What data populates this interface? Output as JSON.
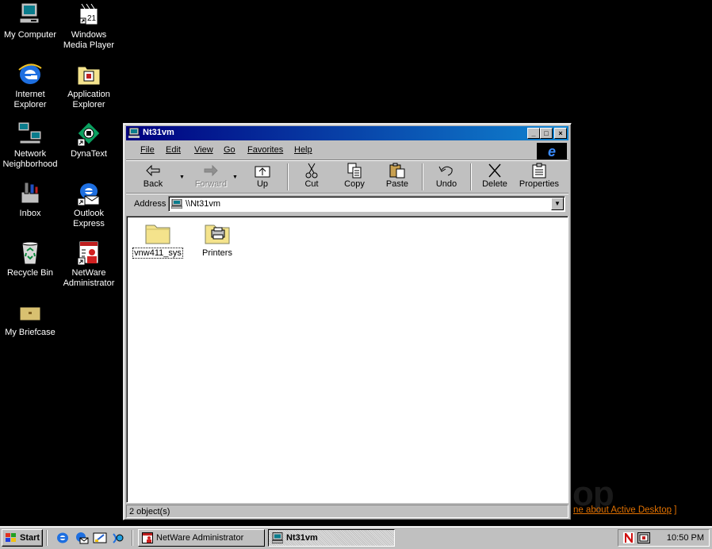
{
  "desktop": {
    "icons": [
      {
        "label": "My Computer",
        "icon": "my-computer-icon"
      },
      {
        "label": "Windows\nMedia Player",
        "icon": "media-player-icon"
      },
      {
        "label": "Internet\nExplorer",
        "icon": "internet-explorer-icon"
      },
      {
        "label": "Application\nExplorer",
        "icon": "application-explorer-icon"
      },
      {
        "label": "Network\nNeighborhood",
        "icon": "network-neighborhood-icon"
      },
      {
        "label": "DynaText",
        "icon": "dynatext-icon"
      },
      {
        "label": "Inbox",
        "icon": "inbox-icon"
      },
      {
        "label": "Outlook\nExpress",
        "icon": "outlook-express-icon"
      },
      {
        "label": "Recycle Bin",
        "icon": "recycle-bin-icon"
      },
      {
        "label": "NetWare\nAdministrator",
        "icon": "netware-administrator-icon"
      },
      {
        "label": "My Briefcase",
        "icon": "briefcase-icon"
      }
    ],
    "background_logo_text": "op",
    "background_link_prefix": "ne about ",
    "background_link_text": "Active Desktop",
    "background_link_suffix": " ]"
  },
  "window": {
    "title": "Nt31vm",
    "controls": {
      "minimize": "_",
      "maximize": "□",
      "close": "×"
    },
    "menu": [
      "File",
      "Edit",
      "View",
      "Go",
      "Favorites",
      "Help"
    ],
    "toolbar": [
      {
        "label": "Back",
        "icon": "back-arrow-icon",
        "enabled": true
      },
      {
        "label": "Forward",
        "icon": "forward-arrow-icon",
        "enabled": false
      },
      {
        "label": "Up",
        "icon": "up-folder-icon",
        "enabled": true
      },
      {
        "label": "Cut",
        "icon": "scissors-icon",
        "enabled": true
      },
      {
        "label": "Copy",
        "icon": "copy-icon",
        "enabled": true
      },
      {
        "label": "Paste",
        "icon": "paste-icon",
        "enabled": true
      },
      {
        "label": "Undo",
        "icon": "undo-icon",
        "enabled": true
      },
      {
        "label": "Delete",
        "icon": "delete-x-icon",
        "enabled": true
      },
      {
        "label": "Properties",
        "icon": "properties-icon",
        "enabled": true
      }
    ],
    "address": {
      "label": "Address",
      "value": "\\\\Nt31vm"
    },
    "items": [
      {
        "label": "vnw411_sys",
        "icon": "folder-icon",
        "selected": true
      },
      {
        "label": "Printers",
        "icon": "printers-folder-icon",
        "selected": false
      }
    ],
    "status": "2 object(s)"
  },
  "taskbar": {
    "start_label": "Start",
    "quick_launch": [
      "internet-explorer-icon",
      "outlook-express-icon",
      "show-desktop-icon",
      "channels-icon"
    ],
    "tasks": [
      {
        "label": "NetWare Administrator",
        "icon": "netware-administrator-icon",
        "active": false
      },
      {
        "label": "Nt31vm",
        "icon": "computer-icon",
        "active": true
      }
    ],
    "tray_icons": [
      "novell-n-icon",
      "tray-app-icon"
    ],
    "clock": "10:50 PM"
  }
}
